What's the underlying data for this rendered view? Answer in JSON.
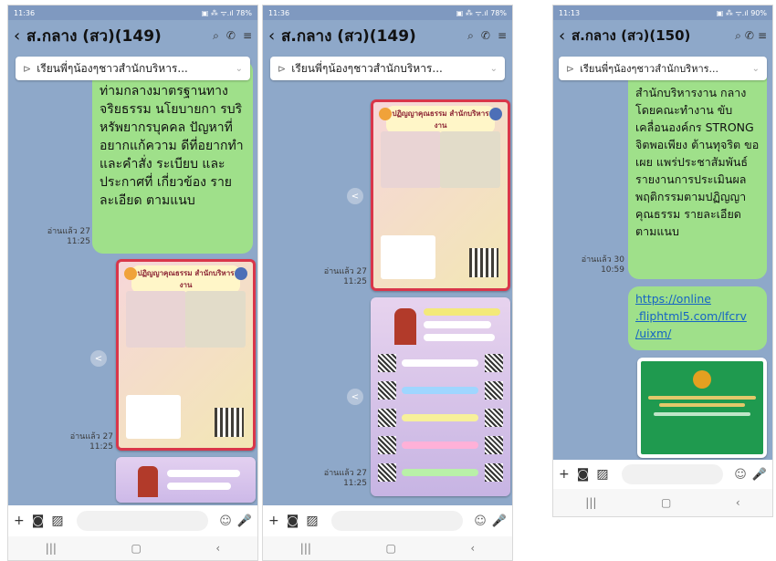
{
  "panels": [
    {
      "status": {
        "time": "11:36",
        "icons": "✉ ··· ▪",
        "right": "▣ ⁂ ᯤ.ıl 78%"
      },
      "title": "ส.กลาง (สว)(149)",
      "pinned": "เรียนพี่ๆน้องๆชาวสำนักบริหาร...",
      "message": "ท่ามกลางมาตรฐานทาง จริยธรรม นโยบายกา รบริหรัพยากรบุคคล ปัญหาที่อยากแก้ความ ดีที่อยากทำ และคำสั่ง ระเบียบ และประกาศที่ เกี่ยวข้อง รายละเอียด ตามแนบ",
      "read1": "อ่านแล้ว 27",
      "time1": "11:25",
      "read2": "อ่านแล้ว 27",
      "time2": "11:25",
      "poster_title": "ปฏิญญาคุณธรรม สำนักบริหารงาน"
    },
    {
      "status": {
        "time": "11:36",
        "icons": "✉ ··· ▪",
        "right": "▣ ⁂ ᯤ.ıl 78%"
      },
      "title": "ส.กลาง (สว)(149)",
      "pinned": "เรียนพี่ๆน้องๆชาวสำนักบริหาร...",
      "read1": "อ่านแล้ว 27",
      "time1": "11:25",
      "read2": "อ่านแล้ว 27",
      "time2": "11:25",
      "poster_title": "ปฏิญญาคุณธรรม สำนักบริหารงาน"
    },
    {
      "status": {
        "time": "11:13",
        "icons": "▣ ◉ 41 ·",
        "right": "▣ ⁂ ᯤ.ıl 90%"
      },
      "title": "ส.กลาง (สว)(150)",
      "pinned": "เรียนพี่ๆน้องๆชาวสำนักบริหาร...",
      "message": "สำนักบริหารงาน กลาง โดยคณะทำงาน ขับเคลื่อนองค์กร STRONG จิตพอเพียง ต้านทุจริต ขอเผย แพร่ประชาสัมพันธ์ รายงานการประเมินผล พฤติกรรมตามปฏิญญา คุณธรรม รายละเอียด ตามแนบ",
      "link": "https://online .fliphtml5.com/lfcrv /uixm/",
      "read1": "อ่านแล้ว 30",
      "time1": "10:59"
    }
  ],
  "icons": {
    "back": "‹",
    "search": "⌕",
    "call": "✆",
    "menu": "≡",
    "plus": "+",
    "camera": "◙",
    "image": "▨",
    "emoji": "☺",
    "mic": "🎙",
    "recent": "|||",
    "home": "▢",
    "backnav": "‹",
    "pin": "⊳",
    "share": "<"
  }
}
